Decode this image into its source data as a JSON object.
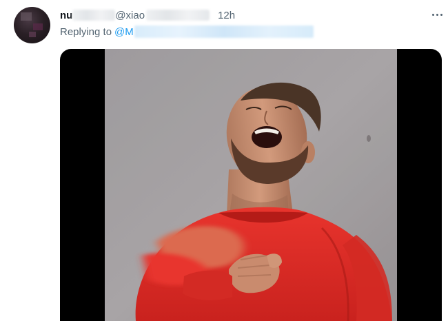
{
  "tweet": {
    "author_name_visible": "nu",
    "handle_visible": "@xiao",
    "time": "12h",
    "reply_label": "Replying to",
    "reply_handle_visible": "@M",
    "more_icon": "more-dots-icon",
    "media_alt": "laughing man in red sweater"
  },
  "colors": {
    "text": "#0f1419",
    "secondary": "#536471",
    "accent": "#1d9bf0",
    "sweater": "#e0302a"
  }
}
